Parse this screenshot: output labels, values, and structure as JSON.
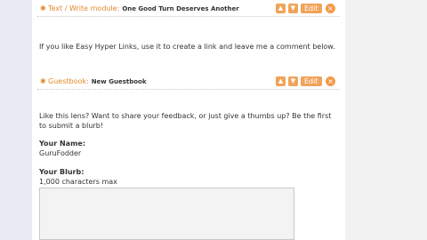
{
  "modules": [
    {
      "type_label": "Text / Write module:",
      "title": "One Good Turn Deserves Another",
      "edit_label": "Edit",
      "body": "If you like Easy Hyper Links, use it to create a link and leave me a comment below."
    },
    {
      "type_label": "Guestbook:",
      "title": "New Guestbook",
      "edit_label": "Edit",
      "body": "Like this lens? Want to share your feedback, or just give a thumbs up? Be the first to submit a blurb!"
    }
  ],
  "form": {
    "name_label": "Your Name:",
    "name_value": "GuruFodder",
    "blurb_label": "Your Blurb:",
    "blurb_hint": "1,000 characters max",
    "blurb_value": ""
  },
  "icons": {
    "bullet": "bullet-icon",
    "move_up": "arrow-up-icon",
    "move_down": "arrow-down-icon",
    "delete": "delete-icon"
  },
  "colors": {
    "accent": "#e08a2c",
    "button": "#f0a45a",
    "sidebar_left": "#e9ecf3"
  }
}
